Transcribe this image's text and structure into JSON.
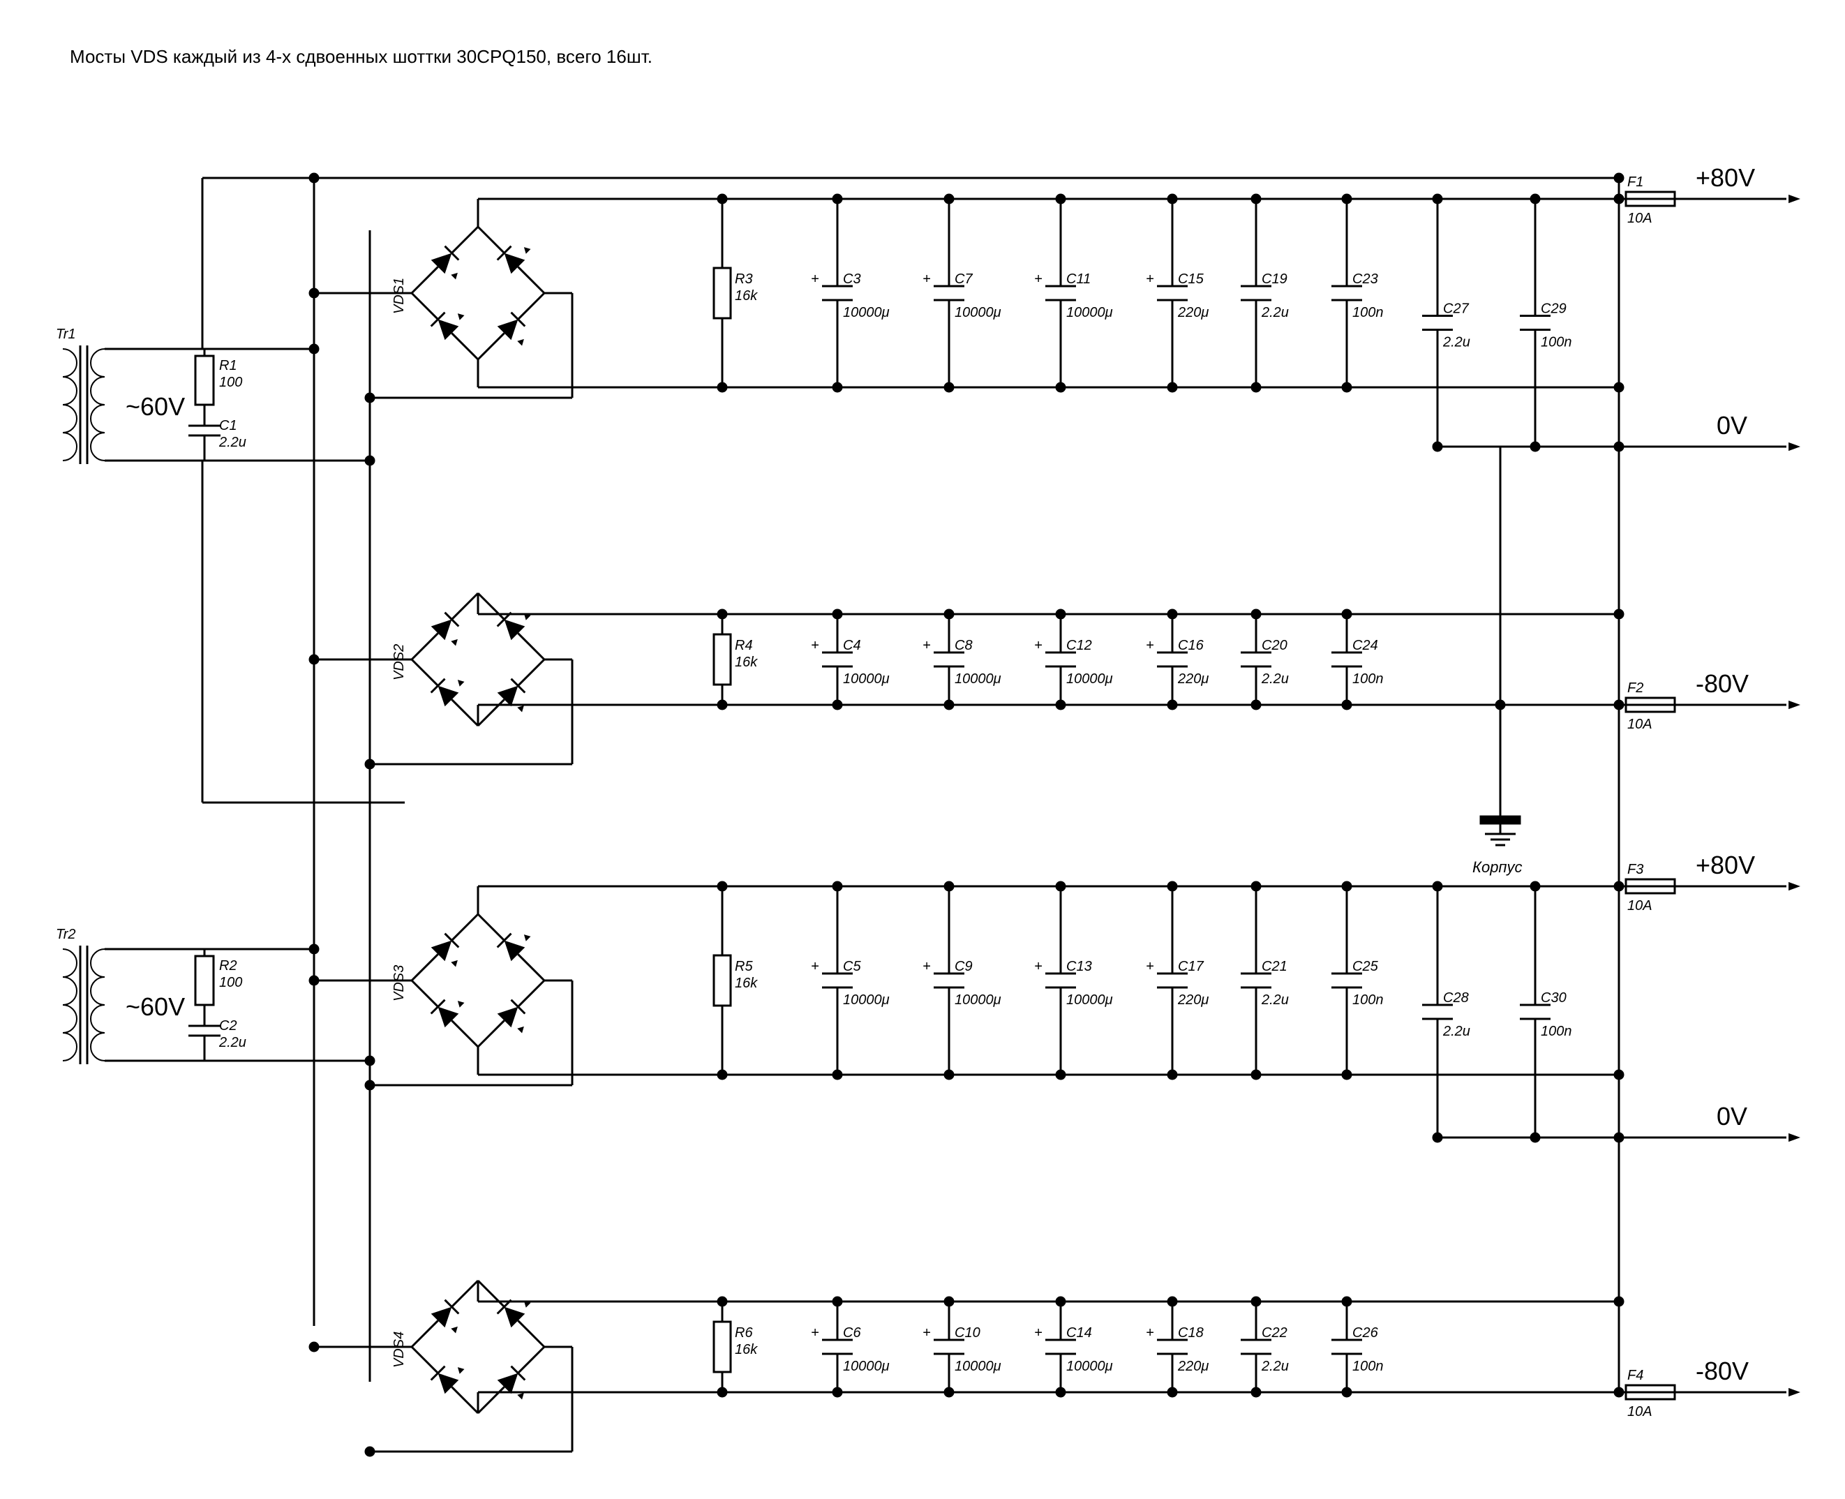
{
  "title": "Мосты VDS каждый из 4-х сдвоенных шоттки 30CPQ150, всего 16шт.",
  "chassis": "Корпус",
  "tr1": {
    "ref": "Tr1",
    "v": "~60V"
  },
  "tr2": {
    "ref": "Tr2",
    "v": "~60V"
  },
  "snub1": {
    "r": {
      "ref": "R1",
      "val": "100"
    },
    "c": {
      "ref": "C1",
      "val": "2.2u"
    }
  },
  "snub2": {
    "r": {
      "ref": "R2",
      "val": "100"
    },
    "c": {
      "ref": "C2",
      "val": "2.2u"
    }
  },
  "bridge": {
    "1": "VDS1",
    "2": "VDS2",
    "3": "VDS3",
    "4": "VDS4"
  },
  "bleed": {
    "1": {
      "ref": "R3",
      "val": "16k"
    },
    "2": {
      "ref": "R4",
      "val": "16k"
    },
    "3": {
      "ref": "R5",
      "val": "16k"
    },
    "4": {
      "ref": "R6",
      "val": "16k"
    }
  },
  "bank": {
    "1": [
      {
        "ref": "C3",
        "val": "10000μ",
        "pol": true
      },
      {
        "ref": "C7",
        "val": "10000μ",
        "pol": true
      },
      {
        "ref": "C11",
        "val": "10000μ",
        "pol": true
      },
      {
        "ref": "C15",
        "val": "220μ",
        "pol": true
      },
      {
        "ref": "C19",
        "val": "2.2u",
        "pol": false
      },
      {
        "ref": "C23",
        "val": "100n",
        "pol": false
      }
    ],
    "2": [
      {
        "ref": "C4",
        "val": "10000μ",
        "pol": true
      },
      {
        "ref": "C8",
        "val": "10000μ",
        "pol": true
      },
      {
        "ref": "C12",
        "val": "10000μ",
        "pol": true
      },
      {
        "ref": "C16",
        "val": "220μ",
        "pol": true
      },
      {
        "ref": "C20",
        "val": "2.2u",
        "pol": false
      },
      {
        "ref": "C24",
        "val": "100n",
        "pol": false
      }
    ],
    "3": [
      {
        "ref": "C5",
        "val": "10000μ",
        "pol": true
      },
      {
        "ref": "C9",
        "val": "10000μ",
        "pol": true
      },
      {
        "ref": "C13",
        "val": "10000μ",
        "pol": true
      },
      {
        "ref": "C17",
        "val": "220μ",
        "pol": true
      },
      {
        "ref": "C21",
        "val": "2.2u",
        "pol": false
      },
      {
        "ref": "C25",
        "val": "100n",
        "pol": false
      }
    ],
    "4": [
      {
        "ref": "C6",
        "val": "10000μ",
        "pol": true
      },
      {
        "ref": "C10",
        "val": "10000μ",
        "pol": true
      },
      {
        "ref": "C14",
        "val": "10000μ",
        "pol": true
      },
      {
        "ref": "C18",
        "val": "220μ",
        "pol": true
      },
      {
        "ref": "C22",
        "val": "2.2u",
        "pol": false
      },
      {
        "ref": "C26",
        "val": "100n",
        "pol": false
      }
    ]
  },
  "mid": {
    "1": [
      {
        "ref": "C27",
        "val": "2.2u"
      },
      {
        "ref": "C29",
        "val": "100n"
      }
    ],
    "2": [
      {
        "ref": "C28",
        "val": "2.2u"
      },
      {
        "ref": "C30",
        "val": "100n"
      }
    ]
  },
  "fuse": {
    "1": {
      "ref": "F1",
      "val": "10A"
    },
    "2": {
      "ref": "F2",
      "val": "10A"
    },
    "3": {
      "ref": "F3",
      "val": "10A"
    },
    "4": {
      "ref": "F4",
      "val": "10A"
    }
  },
  "out": {
    "1": "+80V",
    "2": "-80V",
    "3": "+80V",
    "4": "-80V",
    "0": "0V"
  }
}
